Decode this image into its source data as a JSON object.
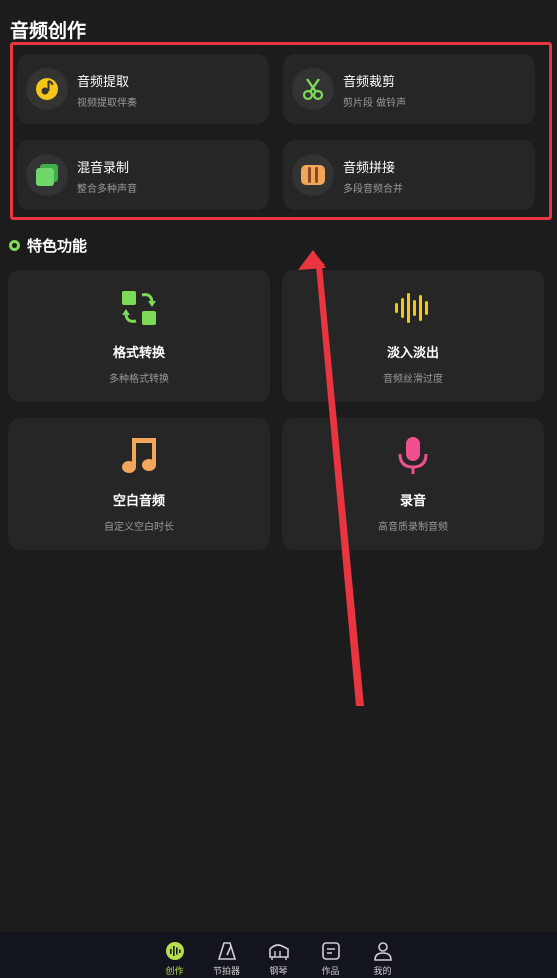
{
  "page_title": "音频创作",
  "tools": [
    {
      "title": "音频提取",
      "subtitle": "视频提取伴奏",
      "icon": "music-disc-icon"
    },
    {
      "title": "音频裁剪",
      "subtitle": "剪片段 做铃声",
      "icon": "scissors-icon"
    },
    {
      "title": "混音录制",
      "subtitle": "整合多种声音",
      "icon": "layers-icon"
    },
    {
      "title": "音频拼接",
      "subtitle": "多段音频合并",
      "icon": "splice-bars-icon"
    }
  ],
  "section": {
    "title": "特色功能"
  },
  "features": [
    {
      "title": "格式转换",
      "subtitle": "多种格式转换",
      "icon": "format-convert-icon"
    },
    {
      "title": "淡入淡出",
      "subtitle": "音频丝滑过度",
      "icon": "waveform-icon"
    },
    {
      "title": "空白音频",
      "subtitle": "自定义空白时长",
      "icon": "music-note-icon"
    },
    {
      "title": "录音",
      "subtitle": "高音质录制音频",
      "icon": "microphone-icon"
    }
  ],
  "nav": [
    {
      "label": "创作",
      "icon": "create-icon",
      "active": true
    },
    {
      "label": "节拍器",
      "icon": "metronome-icon",
      "active": false
    },
    {
      "label": "钢琴",
      "icon": "piano-icon",
      "active": false
    },
    {
      "label": "作品",
      "icon": "works-icon",
      "active": false
    },
    {
      "label": "我的",
      "icon": "profile-icon",
      "active": false
    }
  ],
  "colors": {
    "background": "#1c1c1c",
    "card": "#262626",
    "highlight": "#e8353f",
    "accent_green": "#7ed957",
    "nav_active": "#b6e04b"
  }
}
